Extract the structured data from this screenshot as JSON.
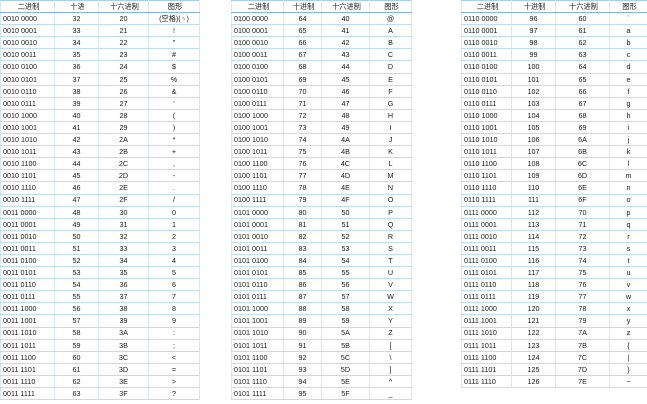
{
  "tables": [
    {
      "headers": [
        "二进制",
        "十进",
        "十六进制",
        "图形"
      ],
      "rows": [
        [
          "0010 0000",
          "32",
          "20",
          "(空格)(␠)"
        ],
        [
          "0010 0001",
          "33",
          "21",
          "!"
        ],
        [
          "0010 0010",
          "34",
          "22",
          "\""
        ],
        [
          "0010 0011",
          "35",
          "23",
          "#"
        ],
        [
          "0010 0100",
          "36",
          "24",
          "$"
        ],
        [
          "0010 0101",
          "37",
          "25",
          "%"
        ],
        [
          "0010 0110",
          "38",
          "26",
          "&"
        ],
        [
          "0010 0111",
          "39",
          "27",
          "'"
        ],
        [
          "0010 1000",
          "40",
          "28",
          "("
        ],
        [
          "0010 1001",
          "41",
          "29",
          ")"
        ],
        [
          "0010 1010",
          "42",
          "2A",
          "*"
        ],
        [
          "0010 1011",
          "43",
          "2B",
          "+"
        ],
        [
          "0010 1100",
          "44",
          "2C",
          ","
        ],
        [
          "0010 1101",
          "45",
          "2D",
          "-"
        ],
        [
          "0010 1110",
          "46",
          "2E",
          "."
        ],
        [
          "0010 1111",
          "47",
          "2F",
          "/"
        ],
        [
          "0011 0000",
          "48",
          "30",
          "0"
        ],
        [
          "0011 0001",
          "49",
          "31",
          "1"
        ],
        [
          "0011 0010",
          "50",
          "32",
          "2"
        ],
        [
          "0011 0011",
          "51",
          "33",
          "3"
        ],
        [
          "0011 0100",
          "52",
          "34",
          "4"
        ],
        [
          "0011 0101",
          "53",
          "35",
          "5"
        ],
        [
          "0011 0110",
          "54",
          "36",
          "6"
        ],
        [
          "0011 0111",
          "55",
          "37",
          "7"
        ],
        [
          "0011 1000",
          "56",
          "38",
          "8"
        ],
        [
          "0011 1001",
          "57",
          "39",
          "9"
        ],
        [
          "0011 1010",
          "58",
          "3A",
          ":"
        ],
        [
          "0011 1011",
          "59",
          "3B",
          ";"
        ],
        [
          "0011 1100",
          "60",
          "3C",
          "<"
        ],
        [
          "0011 1101",
          "61",
          "3D",
          "="
        ],
        [
          "0011 1110",
          "62",
          "3E",
          ">"
        ],
        [
          "0011 1111",
          "63",
          "3F",
          "?"
        ]
      ]
    },
    {
      "headers": [
        "二进制",
        "十进制",
        "十六进制",
        "图形"
      ],
      "rows": [
        [
          "0100 0000",
          "64",
          "40",
          "@"
        ],
        [
          "0100 0001",
          "65",
          "41",
          "A"
        ],
        [
          "0100 0010",
          "66",
          "42",
          "B"
        ],
        [
          "0100 0011",
          "67",
          "43",
          "C"
        ],
        [
          "0100 0100",
          "68",
          "44",
          "D"
        ],
        [
          "0100 0101",
          "69",
          "45",
          "E"
        ],
        [
          "0100 0110",
          "70",
          "46",
          "F"
        ],
        [
          "0100 0111",
          "71",
          "47",
          "G"
        ],
        [
          "0100 1000",
          "72",
          "48",
          "H"
        ],
        [
          "0100 1001",
          "73",
          "49",
          "I"
        ],
        [
          "0100 1010",
          "74",
          "4A",
          "J"
        ],
        [
          "0100 1011",
          "75",
          "4B",
          "K"
        ],
        [
          "0100 1100",
          "76",
          "4C",
          "L"
        ],
        [
          "0100 1101",
          "77",
          "4D",
          "M"
        ],
        [
          "0100 1110",
          "78",
          "4E",
          "N"
        ],
        [
          "0100 1111",
          "79",
          "4F",
          "O"
        ],
        [
          "0101 0000",
          "80",
          "50",
          "P"
        ],
        [
          "0101 0001",
          "81",
          "51",
          "Q"
        ],
        [
          "0101 0010",
          "82",
          "52",
          "R"
        ],
        [
          "0101 0011",
          "83",
          "53",
          "S"
        ],
        [
          "0101 0100",
          "84",
          "54",
          "T"
        ],
        [
          "0101 0101",
          "85",
          "55",
          "U"
        ],
        [
          "0101 0110",
          "86",
          "56",
          "V"
        ],
        [
          "0101 0111",
          "87",
          "57",
          "W"
        ],
        [
          "0101 1000",
          "88",
          "58",
          "X"
        ],
        [
          "0101 1001",
          "89",
          "59",
          "Y"
        ],
        [
          "0101 1010",
          "90",
          "5A",
          "Z"
        ],
        [
          "0101 1011",
          "91",
          "5B",
          "["
        ],
        [
          "0101 1100",
          "92",
          "5C",
          "\\"
        ],
        [
          "0101 1101",
          "93",
          "5D",
          "]"
        ],
        [
          "0101 1110",
          "94",
          "5E",
          "^"
        ],
        [
          "0101 1111",
          "95",
          "5F",
          "_"
        ]
      ]
    },
    {
      "headers": [
        "二进制",
        "十进制",
        "十六进制",
        "图形"
      ],
      "rows": [
        [
          "0110 0000",
          "96",
          "60",
          "`"
        ],
        [
          "0110 0001",
          "97",
          "61",
          "a"
        ],
        [
          "0110 0010",
          "98",
          "62",
          "b"
        ],
        [
          "0110 0011",
          "99",
          "63",
          "c"
        ],
        [
          "0110 0100",
          "100",
          "64",
          "d"
        ],
        [
          "0110 0101",
          "101",
          "65",
          "e"
        ],
        [
          "0110 0110",
          "102",
          "66",
          "f"
        ],
        [
          "0110 0111",
          "103",
          "67",
          "g"
        ],
        [
          "0110 1000",
          "104",
          "68",
          "h"
        ],
        [
          "0110 1001",
          "105",
          "69",
          "i"
        ],
        [
          "0110 1010",
          "106",
          "6A",
          "j"
        ],
        [
          "0110 1011",
          "107",
          "6B",
          "k"
        ],
        [
          "0110 1100",
          "108",
          "6C",
          "l"
        ],
        [
          "0110 1101",
          "109",
          "6D",
          "m"
        ],
        [
          "0110 1110",
          "110",
          "6E",
          "n"
        ],
        [
          "0110 1111",
          "111",
          "6F",
          "o"
        ],
        [
          "0111 0000",
          "112",
          "70",
          "p"
        ],
        [
          "0111 0001",
          "113",
          "71",
          "q"
        ],
        [
          "0111 0010",
          "114",
          "72",
          "r"
        ],
        [
          "0111 0011",
          "115",
          "73",
          "s"
        ],
        [
          "0111 0100",
          "116",
          "74",
          "t"
        ],
        [
          "0111 0101",
          "117",
          "75",
          "u"
        ],
        [
          "0111 0110",
          "118",
          "76",
          "v"
        ],
        [
          "0111 0111",
          "119",
          "77",
          "w"
        ],
        [
          "0111 1000",
          "120",
          "78",
          "x"
        ],
        [
          "0111 1001",
          "121",
          "79",
          "y"
        ],
        [
          "0111 1010",
          "122",
          "7A",
          "z"
        ],
        [
          "0111 1011",
          "123",
          "7B",
          "{"
        ],
        [
          "0111 1100",
          "124",
          "7C",
          "|"
        ],
        [
          "0111 1101",
          "125",
          "7D",
          "}"
        ],
        [
          "0111 1110",
          "126",
          "7E",
          "~"
        ]
      ]
    }
  ]
}
